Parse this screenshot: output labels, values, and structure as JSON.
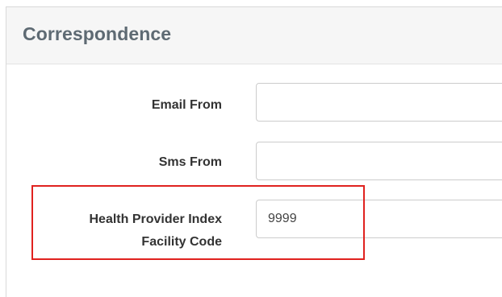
{
  "panel": {
    "title": "Correspondence"
  },
  "fields": {
    "email_from": {
      "label": "Email From",
      "value": ""
    },
    "sms_from": {
      "label": "Sms From",
      "value": ""
    },
    "health_provider_index": {
      "label_line1": "Health Provider Index",
      "label_line2": "Facility Code",
      "value": "9999"
    }
  },
  "colors": {
    "highlight": "#e0221f",
    "title": "#5e6a73",
    "header_bg": "#f6f6f6"
  }
}
